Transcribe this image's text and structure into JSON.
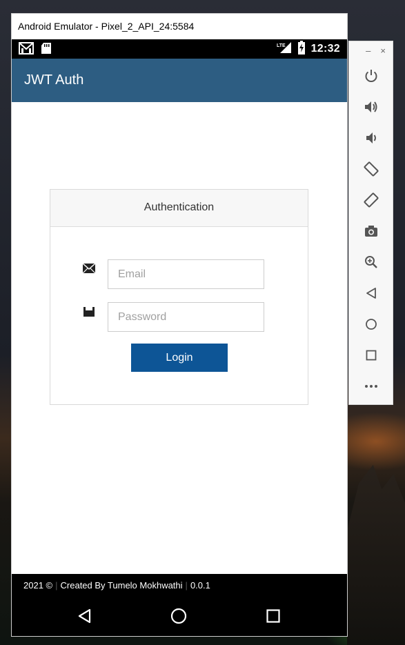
{
  "window": {
    "title": "Android Emulator - Pixel_2_API_24:5584"
  },
  "status_bar": {
    "time": "12:32",
    "network": "LTE",
    "icons_left": [
      "gmail-icon",
      "sd-card-icon"
    ],
    "icons_right": [
      "lte-signal-icon",
      "battery-charging-icon"
    ]
  },
  "app_bar": {
    "title": "JWT Auth",
    "color": "#2d5d82"
  },
  "login_card": {
    "header": "Authentication",
    "email": {
      "placeholder": "Email",
      "value": ""
    },
    "password": {
      "placeholder": "Password",
      "value": ""
    },
    "login_label": "Login",
    "button_color": "#0d5596"
  },
  "footer": {
    "year": "2021 ©",
    "author": "Created By Tumelo Mokhwathi",
    "version": "0.0.1"
  },
  "nav_bar": {
    "buttons": [
      "back-icon",
      "home-icon",
      "recents-icon"
    ]
  },
  "side_toolbar": {
    "minimize_label": "–",
    "close_label": "×",
    "buttons": [
      "power-icon",
      "volume-up-icon",
      "volume-down-icon",
      "rotate-left-icon",
      "rotate-right-icon",
      "camera-icon",
      "zoom-icon",
      "back-icon",
      "home-icon",
      "overview-icon",
      "more-icon"
    ]
  }
}
